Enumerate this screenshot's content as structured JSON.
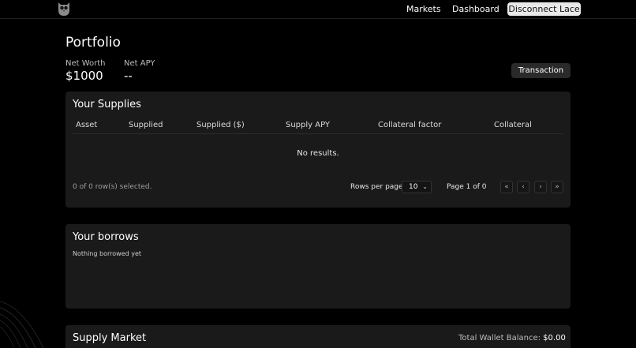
{
  "nav": {
    "markets": "Markets",
    "dashboard": "Dashboard",
    "disconnect": "Disconnect Lace"
  },
  "portfolio": {
    "title": "Portfolio",
    "net_worth_label": "Net Worth",
    "net_worth_value": "$1000",
    "net_apy_label": "Net APY",
    "net_apy_value": "--",
    "transaction_button": "Transaction"
  },
  "supplies": {
    "title": "Your Supplies",
    "columns": [
      "Asset",
      "Supplied",
      "Supplied ($)",
      "Supply APY",
      "Collateral factor",
      "Collateral"
    ],
    "empty_text": "No results.",
    "selection_text": "0 of 0 row(s) selected.",
    "rows_per_page_label": "Rows per page",
    "rows_per_page_value": "10",
    "page_text": "Page 1 of 0",
    "pagination_icons": [
      "first-page-icon",
      "previous-page-icon",
      "next-page-icon",
      "last-page-icon"
    ]
  },
  "borrows": {
    "title": "Your borrows",
    "empty_text": "Nothing borrowed yet"
  },
  "supply_market": {
    "title": "Supply Market",
    "balance_label": "Total Wallet Balance:",
    "balance_value": "$0.00"
  },
  "colors": {
    "background": "#000000",
    "card": "#1a1a1a",
    "button_light": "#e9e9e9",
    "button_dark": "#2a2a2a"
  }
}
